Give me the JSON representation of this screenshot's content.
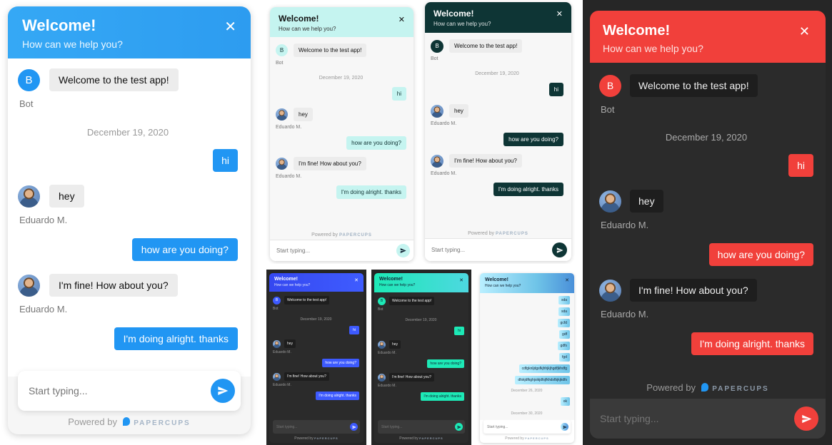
{
  "header": {
    "title": "Welcome!",
    "subtitle": "How can we help you?"
  },
  "conversation": {
    "bot_greeting": "Welcome to the test app!",
    "bot_name": "Bot",
    "bot_initial": "B",
    "date": "December 19, 2020",
    "msg_hi": "hi",
    "msg_hey": "hey",
    "agent_name": "Eduardo M.",
    "msg_how_are_you": "how are you doing?",
    "msg_fine": "I'm fine! How about you?",
    "msg_alright": "I'm doing alright. thanks"
  },
  "composer": {
    "placeholder": "Start typing..."
  },
  "footer": {
    "powered_by": "Powered by",
    "brand": "PAPERCUPS"
  },
  "spam_thread": {
    "messages": [
      "sda",
      "sda",
      "gcfd",
      "gdf",
      "gdfs",
      "fgd",
      "cdfgknljdgsfkjhhjkjhgdfjkhdfg",
      "dfskjdfkghjsikjdfsjfkhdsfbjkjkdfs"
    ],
    "date_1": "December 26, 2020",
    "msg_ok": "ok",
    "date_2": "December 30, 2020"
  },
  "colors": {
    "blue_accent": "#2196f3",
    "light_blue_accent": "#80deea",
    "dark_teal_accent": "#0e3535",
    "indigo_accent": "#3d5afe",
    "teal_gradient_accent": "#1de9b6",
    "red_accent": "#f44336",
    "dark_background": "#2b2b2b"
  }
}
